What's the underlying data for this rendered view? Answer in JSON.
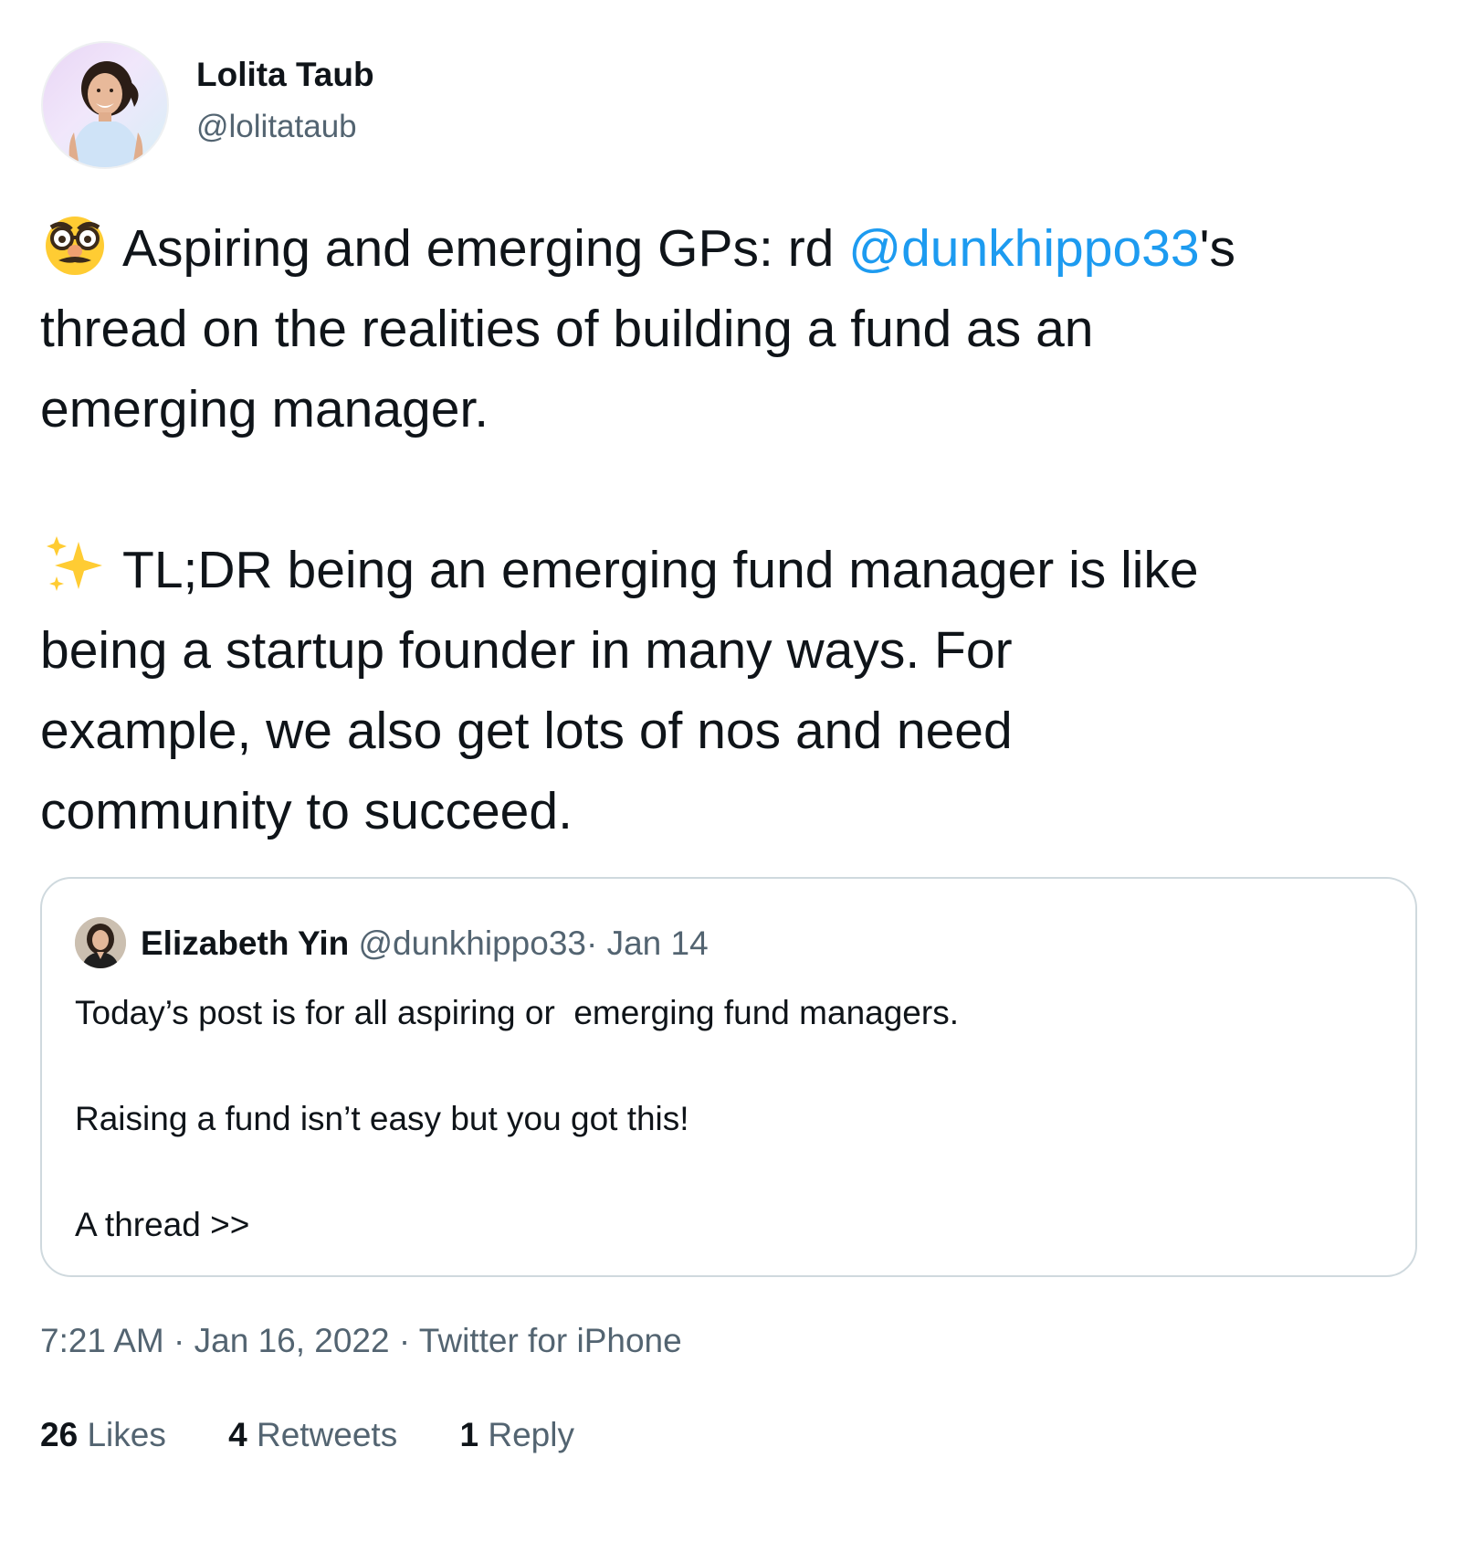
{
  "author": {
    "name": "Lolita Taub",
    "handle": "@lolitataub",
    "avatar_icon": "profile-photo"
  },
  "tweet": {
    "line1_emoji": "disguised-face-emoji",
    "line1_text": "Aspiring and emerging GPs: rd ",
    "line1_mention": "@dunkhippo33",
    "line1_suffix": "'s",
    "line2": "thread on the realities of building a fund as an",
    "line3": "emerging manager.",
    "line4_emoji": "sparkles-emoji",
    "line4_text": "TL;DR being an emerging fund manager is like",
    "line5": "being a startup founder in many ways. For",
    "line6": "example,  we also get lots of nos and need",
    "line7": "community to succeed.",
    "mention_color": "#1d9bf0"
  },
  "quoted": {
    "name": "Elizabeth Yin",
    "handle": "@dunkhippo33",
    "separator": "·",
    "date": "Jan 14",
    "line1": "Today’s post is for all aspiring or  emerging fund managers.",
    "line2": "Raising a fund isn’t easy but you got this!",
    "line3": "A thread >>"
  },
  "meta": {
    "text": "7:21 AM · Jan 16, 2022 · Twitter for iPhone"
  },
  "stats": {
    "likes_count": "26",
    "likes_label": "Likes",
    "retweets_count": "4",
    "retweets_label": "Retweets",
    "replies_count": "1",
    "replies_label": "Reply"
  }
}
